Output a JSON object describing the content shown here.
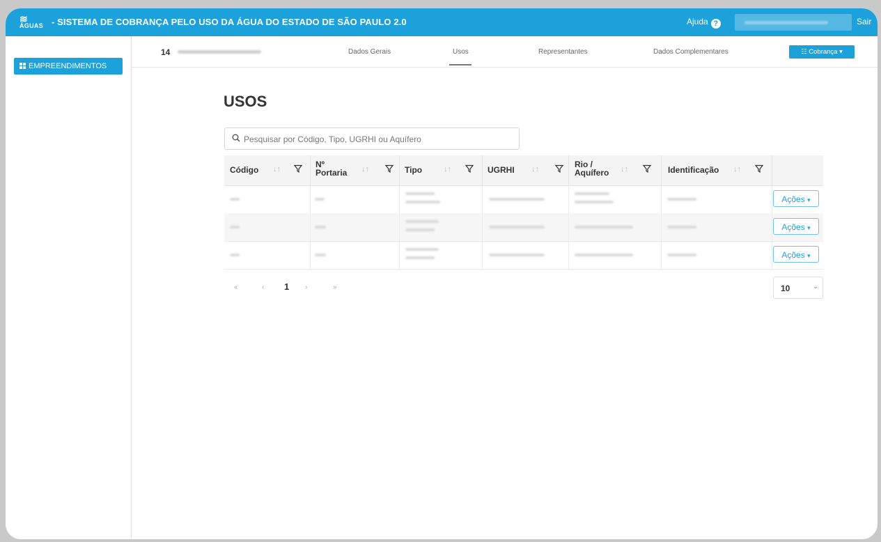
{
  "topbar": {
    "logo_text": "ÁGUAS",
    "title": "- SISTEMA DE COBRANÇA PELO USO DA ÁGUA DO ESTADO DE SÃO PAULO 2.0",
    "help_label": "Ajuda",
    "help_icon": "question-circle-icon",
    "logout_label": "Sair"
  },
  "sidebar": {
    "items": [
      {
        "label": "EMPREENDIMENTOS",
        "icon": "grid-icon"
      }
    ]
  },
  "record": {
    "id": "14"
  },
  "tabs": [
    {
      "label": "Dados Gerais"
    },
    {
      "label": "Usos",
      "active": true
    },
    {
      "label": "Representantes"
    },
    {
      "label": "Dados Complementares"
    }
  ],
  "cobranca_button": {
    "label": "Cobrança",
    "icon": "sliders-icon"
  },
  "main": {
    "title": "USOS",
    "search_placeholder": "Pesquisar por Código, Tipo, UGRHI ou Aquífero"
  },
  "table": {
    "columns": [
      {
        "label": "Código"
      },
      {
        "label_line1": "Nº",
        "label_line2": "Portaria"
      },
      {
        "label": "Tipo"
      },
      {
        "label": "UGRHI"
      },
      {
        "label_line1": "Rio /",
        "label_line2": "Aquífero"
      },
      {
        "label": "Identificação"
      }
    ],
    "row_action_label": "Ações"
  },
  "pagination": {
    "first": "«",
    "prev": "‹",
    "current_page": "1",
    "next": "›",
    "last": "»",
    "page_size": "10"
  },
  "colors": {
    "primary": "#1da1db",
    "text": "#333333"
  }
}
